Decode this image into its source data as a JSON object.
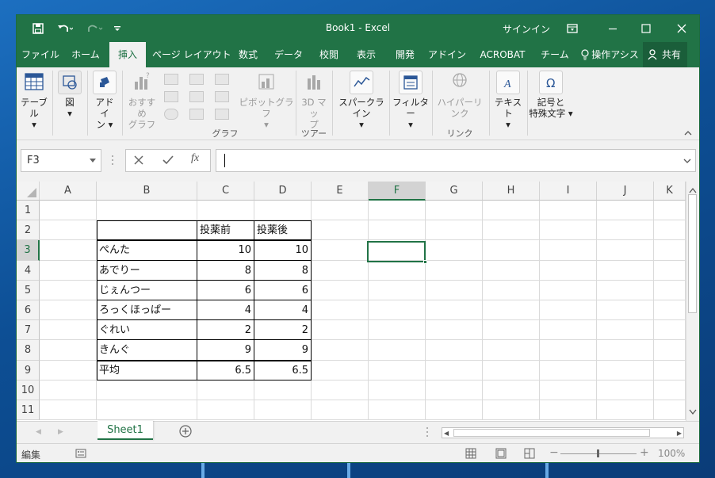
{
  "window": {
    "title": "Book1 - Excel",
    "signin": "サインイン"
  },
  "tabs": [
    {
      "label": "ファイル"
    },
    {
      "label": "ホーム"
    },
    {
      "label": "挿入"
    },
    {
      "label": "ページ レイアウト"
    },
    {
      "label": "数式"
    },
    {
      "label": "データ"
    },
    {
      "label": "校閲"
    },
    {
      "label": "表示"
    },
    {
      "label": "開発"
    },
    {
      "label": "アドイン"
    },
    {
      "label": "ACROBAT"
    },
    {
      "label": "チーム"
    },
    {
      "label": "操作アシス"
    },
    {
      "label": "共有"
    }
  ],
  "ribbon": {
    "table": "テーブル",
    "figure": "図",
    "addin_line1": "アドイ",
    "addin_line2": "ン",
    "rec_line1": "おすすめ",
    "rec_line2": "グラフ",
    "pivot": "ピボットグラフ",
    "map_line1": "3D マッ",
    "map_line2": "プ",
    "sparkline": "スパークライン",
    "filter": "フィルター",
    "hyperlink": "ハイパーリンク",
    "text": "テキスト",
    "symbol_line1": "記号と",
    "symbol_line2": "特殊文字",
    "group_graph": "グラフ",
    "group_tour": "ツアー",
    "group_link": "リンク"
  },
  "formula_bar": {
    "name_box": "F3",
    "fx": "fx",
    "value": ""
  },
  "columns": [
    "A",
    "B",
    "C",
    "D",
    "E",
    "F",
    "G",
    "H",
    "I",
    "J",
    "K"
  ],
  "rows": [
    "1",
    "2",
    "3",
    "4",
    "5",
    "6",
    "7",
    "8",
    "9",
    "10",
    "11"
  ],
  "selected_cell": "F3",
  "table": {
    "header": [
      "",
      "投薬前",
      "投薬後"
    ],
    "data": [
      [
        "ぺんた",
        "10",
        "10"
      ],
      [
        "あでりー",
        "8",
        "8"
      ],
      [
        "じぇんつー",
        "6",
        "6"
      ],
      [
        "ろっくほっぱー",
        "4",
        "4"
      ],
      [
        "ぐれい",
        "2",
        "2"
      ],
      [
        "きんぐ",
        "9",
        "9"
      ]
    ],
    "footer": [
      "平均",
      "6.5",
      "6.5"
    ]
  },
  "sheets": [
    {
      "name": "Sheet1"
    }
  ],
  "status": {
    "mode": "編集",
    "zoom": "100%"
  },
  "colors": {
    "accent": "#217346",
    "ribbon_bg": "#f1f1f1"
  }
}
